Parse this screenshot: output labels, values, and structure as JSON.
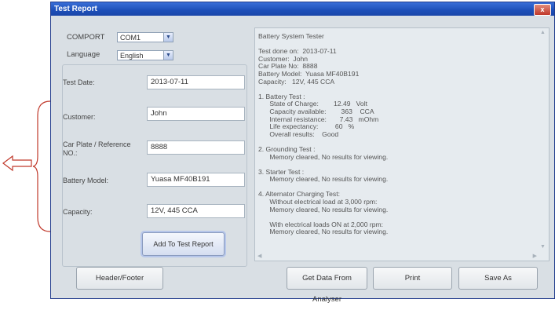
{
  "window": {
    "title": "Test Report",
    "close_glyph": "x"
  },
  "settings": {
    "comport_label": "COMPORT",
    "comport_value": "COM1",
    "language_label": "Language",
    "language_value": "English"
  },
  "form": {
    "fields": [
      {
        "label": "Test Date:",
        "value": "2013-07-11"
      },
      {
        "label": "Customer:",
        "value": "John"
      },
      {
        "label": "Car Plate / Reference NO.:",
        "value": "8888"
      },
      {
        "label": "Battery Model:",
        "value": "Yuasa MF40B191"
      },
      {
        "label": "Capacity:",
        "value": "12V, 445 CCA"
      }
    ],
    "add_button": "Add To Test Report"
  },
  "report": {
    "lines": [
      "Battery System Tester",
      "",
      "Test done on:  2013-07-11",
      "Customer:  John",
      "Car Plate No:  8888",
      "Battery Model:  Yuasa MF40B191",
      "Capacity:   12V, 445 CCA",
      "",
      "1. Battery Test :",
      "      State of Charge:        12.49   Volt",
      "      Capacity available:        363    CCA",
      "      Internal resistance:       7.43   mOhm",
      "      Life expectancy:         60   %",
      "      Overall results:    Good",
      "",
      "2. Grounding Test :",
      "      Memory cleared, No results for viewing.",
      "",
      "3. Starter Test :",
      "      Memory cleared, No results for viewing.",
      "",
      "4. Alternator Charging Test:",
      "      Without electrical load at 3,000 rpm:",
      "      Memory cleared, No results for viewing.",
      "",
      "      With electrical loads ON at 2,000 rpm:",
      "      Memory cleared, No results for viewing."
    ]
  },
  "buttons": {
    "header_footer": "Header/Footer",
    "get_data": "Get Data From Analyser",
    "print": "Print",
    "save_as": "Save As"
  },
  "colors": {
    "titlebar": "#1d4fb8",
    "annotation": "#c0392b",
    "window_bg": "#d9dfe4"
  }
}
